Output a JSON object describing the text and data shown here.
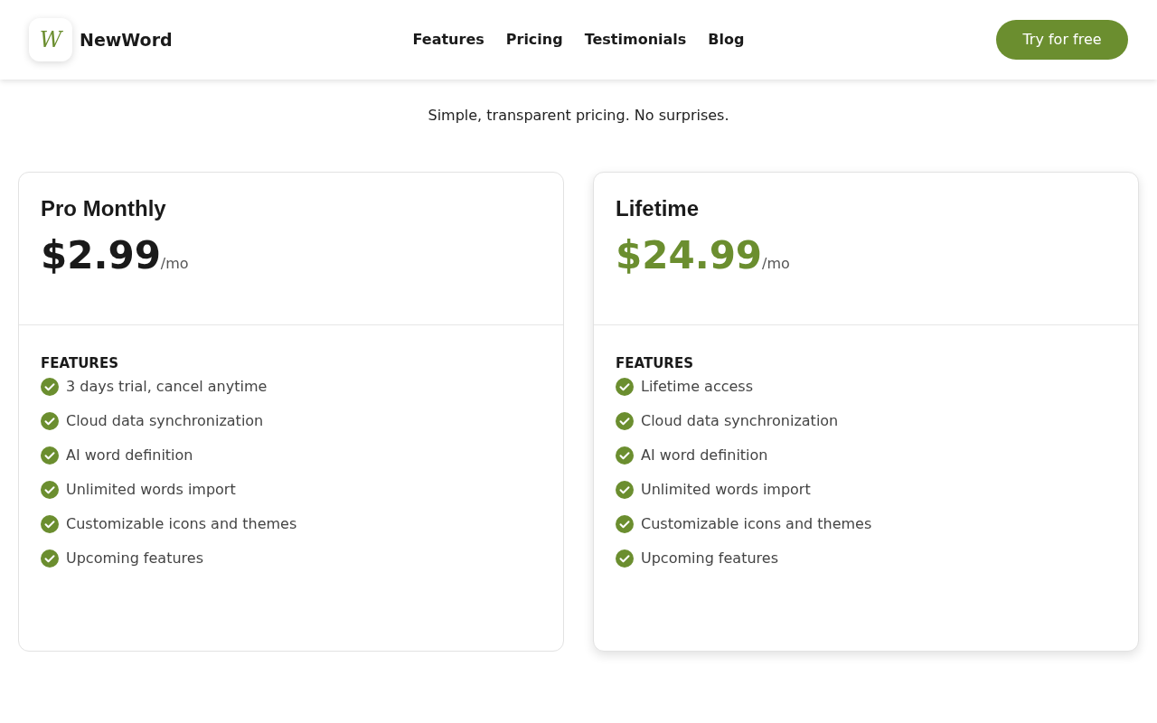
{
  "header": {
    "logo_letter": "W",
    "brand": "NewWord",
    "nav": [
      {
        "label": "Features"
      },
      {
        "label": "Pricing"
      },
      {
        "label": "Testimonials"
      },
      {
        "label": "Blog"
      }
    ],
    "cta": "Try for free"
  },
  "subtitle": "Simple, transparent pricing. No surprises.",
  "plans": [
    {
      "name": "Pro Monthly",
      "price": "$2.99",
      "period": "/mo",
      "highlighted": false,
      "features_title": "FEATURES",
      "features": [
        "3 days trial, cancel anytime",
        "Cloud data synchronization",
        "AI word definition",
        "Unlimited words import",
        "Customizable icons and themes",
        "Upcoming features"
      ]
    },
    {
      "name": "Lifetime",
      "price": "$24.99",
      "period": "/mo",
      "highlighted": true,
      "features_title": "FEATURES",
      "features": [
        "Lifetime access",
        "Cloud data synchronization",
        "AI word definition",
        "Unlimited words import",
        "Customizable icons and themes",
        "Upcoming features"
      ]
    }
  ]
}
